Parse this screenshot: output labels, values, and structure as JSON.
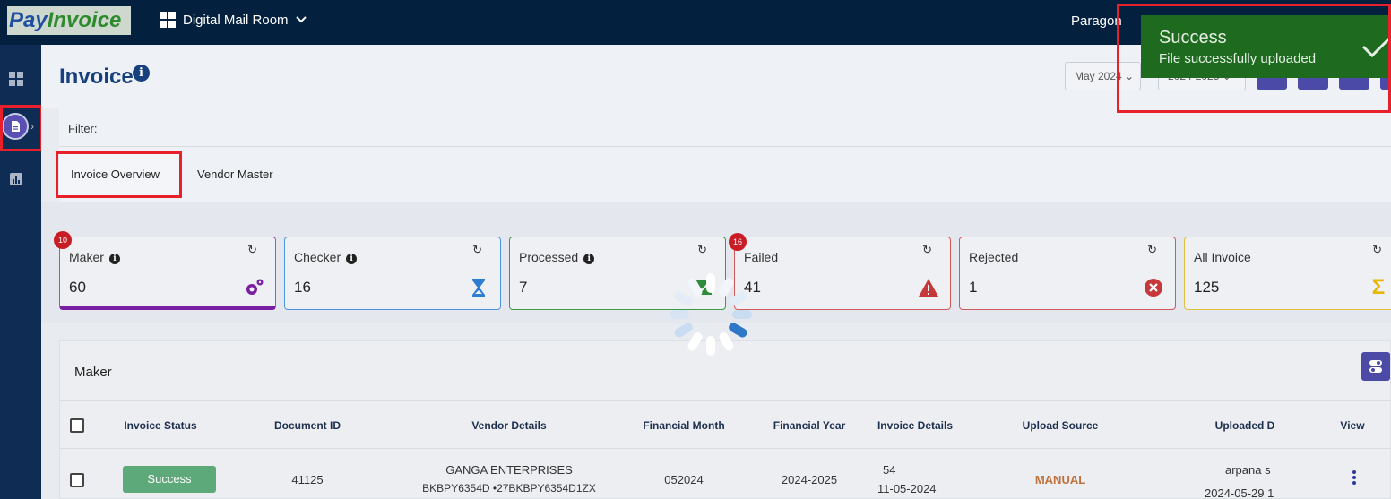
{
  "header": {
    "logo_part1": "Pay",
    "logo_part2": "Invoice",
    "module": "Digital Mail Room",
    "user": "Paragon"
  },
  "sidebar": {
    "items": [
      "dashboard-icon",
      "document-icon",
      "report-icon"
    ]
  },
  "page": {
    "title": "Invoice",
    "month_select": "May 2024",
    "year_select": "2024-2025",
    "filter_label": "Filter:"
  },
  "tabs": [
    {
      "label": "Invoice Overview",
      "active": true
    },
    {
      "label": "Vendor Master",
      "active": false
    }
  ],
  "cards": [
    {
      "label": "Maker",
      "value": "60",
      "badge": "10",
      "color": "#7b1fa2",
      "icon": "gears-icon"
    },
    {
      "label": "Checker",
      "value": "16",
      "color": "#2f7dd1",
      "icon": "hourglass-icon"
    },
    {
      "label": "Processed",
      "value": "7",
      "color": "#2e8b3a",
      "icon": "invoice-check-icon"
    },
    {
      "label": "Failed",
      "value": "41",
      "badge": "16",
      "color": "#c6393a",
      "icon": "warning-icon"
    },
    {
      "label": "Rejected",
      "value": "1",
      "color": "#c6393a",
      "icon": "close-circle-icon"
    },
    {
      "label": "All Invoice",
      "value": "125",
      "color": "#e6b800",
      "icon": "sigma-icon"
    }
  ],
  "table": {
    "title": "Maker",
    "columns": [
      "Invoice Status",
      "Document ID",
      "Vendor Details",
      "Financial Month",
      "Financial Year",
      "Invoice Details",
      "Upload Source",
      "Uploaded D",
      "View"
    ],
    "rows": [
      {
        "status": "Success",
        "document_id": "41125",
        "vendor_name": "GANGA ENTERPRISES",
        "vendor_ids": "BKBPY6354D  •27BKBPY6354D1ZX",
        "financial_month": "052024",
        "financial_year": "2024-2025",
        "invoice_no": "54",
        "invoice_date": "11-05-2024",
        "upload_source": "MANUAL",
        "uploaded_by": "arpana s",
        "uploaded_date": "2024-05-29 1"
      }
    ]
  },
  "toast": {
    "title": "Success",
    "message": "File successfully uploaded"
  }
}
